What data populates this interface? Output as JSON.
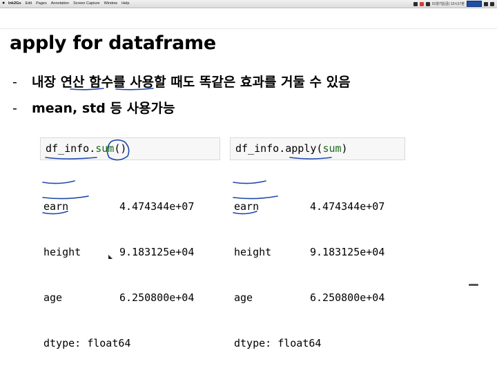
{
  "menubar": {
    "app_name": "Ink2Go",
    "items": [
      "Edit",
      "Pages",
      "Annotation",
      "Screen Capture",
      "Window",
      "Help"
    ],
    "status_text": "01월7일(금)  12시17분"
  },
  "slide": {
    "title": "apply for dataframe",
    "bullets": [
      "내장 연산 함수를 사용할 때도 똑같은 효과를 거둘 수 있음",
      "mean, std 등 사용가능"
    ],
    "bullet_marker": "-"
  },
  "cells": [
    {
      "code_obj": "df_info.",
      "code_fn": "sum",
      "code_suffix": "()",
      "output": [
        {
          "key": "earn",
          "value": "4.474344e+07"
        },
        {
          "key": "height",
          "value": "9.183125e+04"
        },
        {
          "key": "age",
          "value": "6.250800e+04"
        }
      ],
      "dtype": "dtype: float64"
    },
    {
      "code_obj": "df_info.",
      "code_fn": "apply(",
      "code_arg": "sum",
      "code_suffix": ")",
      "output": [
        {
          "key": "earn",
          "value": "4.474344e+07"
        },
        {
          "key": "height",
          "value": "9.183125e+04"
        },
        {
          "key": "age",
          "value": "6.250800e+04"
        }
      ],
      "dtype": "dtype: float64"
    }
  ],
  "colors": {
    "ink": "#1f47a8",
    "keyword": "#1b6b1b",
    "code_bg": "#f7f7f7"
  }
}
